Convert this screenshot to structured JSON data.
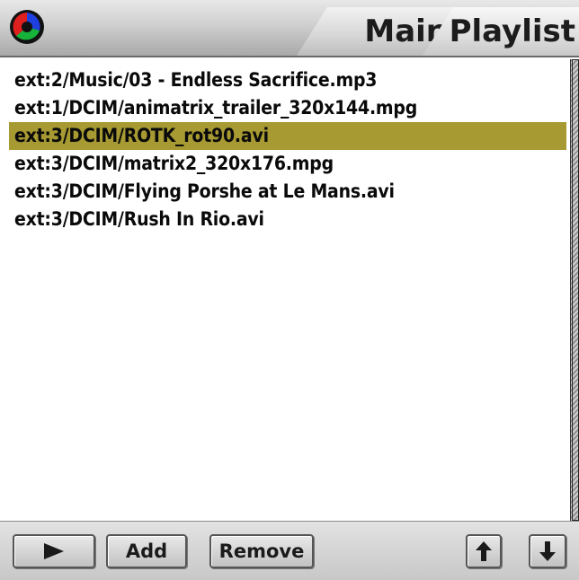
{
  "header": {
    "logo_icon": "colorful-circle-logo-icon",
    "tabs": [
      {
        "label": "Main",
        "active": false
      },
      {
        "label": "Playlist",
        "active": true
      }
    ]
  },
  "playlist": {
    "items": [
      {
        "label": "ext:2/Music/03 - Endless Sacrifice.mp3",
        "selected": false
      },
      {
        "label": "ext:1/DCIM/animatrix_trailer_320x144.mpg",
        "selected": false
      },
      {
        "label": "ext:3/DCIM/ROTK_rot90.avi",
        "selected": true
      },
      {
        "label": "ext:3/DCIM/matrix2_320x176.mpg",
        "selected": false
      },
      {
        "label": "ext:3/DCIM/Flying Porshe at Le Mans.avi",
        "selected": false
      },
      {
        "label": "ext:3/DCIM/Rush In Rio.avi",
        "selected": false
      }
    ],
    "selection_color": "#a79a32"
  },
  "toolbar": {
    "play_icon": "play-icon",
    "add_label": "Add",
    "remove_label": "Remove",
    "move_up_icon": "arrow-up-icon",
    "move_down_icon": "arrow-down-icon"
  }
}
